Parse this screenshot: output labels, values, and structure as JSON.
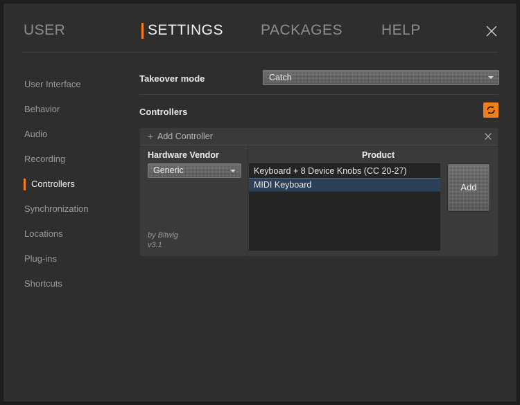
{
  "window": {
    "accent_color": "#ff7b1a",
    "background_color": "#2e2e2e",
    "close_icon": "close-icon"
  },
  "header": {
    "tabs": [
      {
        "label": "USER",
        "active": false
      },
      {
        "label": "SETTINGS",
        "active": true
      },
      {
        "label": "PACKAGES",
        "active": false
      },
      {
        "label": "HELP",
        "active": false
      }
    ],
    "close_label": "×"
  },
  "sidebar": {
    "items": [
      {
        "label": "User Interface",
        "active": false
      },
      {
        "label": "Behavior",
        "active": false
      },
      {
        "label": "Audio",
        "active": false
      },
      {
        "label": "Recording",
        "active": false
      },
      {
        "label": "Controllers",
        "active": true
      },
      {
        "label": "Synchronization",
        "active": false
      },
      {
        "label": "Locations",
        "active": false
      },
      {
        "label": "Plug-ins",
        "active": false
      },
      {
        "label": "Shortcuts",
        "active": false
      }
    ]
  },
  "main": {
    "takeover": {
      "label": "Takeover mode",
      "value": "Catch",
      "caret_icon": "chevron-down-icon"
    },
    "controllers": {
      "label": "Controllers",
      "refresh_icon": "refresh-icon",
      "refresh_color": "#f28019"
    },
    "add_panel": {
      "plus_icon": "plus-icon",
      "plus_glyph": "+",
      "title": "Add Controller",
      "close_icon": "close-icon",
      "vendor": {
        "header": "Hardware Vendor",
        "value": "Generic",
        "caret_icon": "chevron-down-icon",
        "author": "by Bitwig",
        "version": "v3.1"
      },
      "product": {
        "header": "Product",
        "items": [
          {
            "label": "Keyboard + 8 Device Knobs (CC 20-27)",
            "selected": false
          },
          {
            "label": "MIDI Keyboard",
            "selected": true
          }
        ]
      },
      "add_button_label": "Add"
    }
  }
}
